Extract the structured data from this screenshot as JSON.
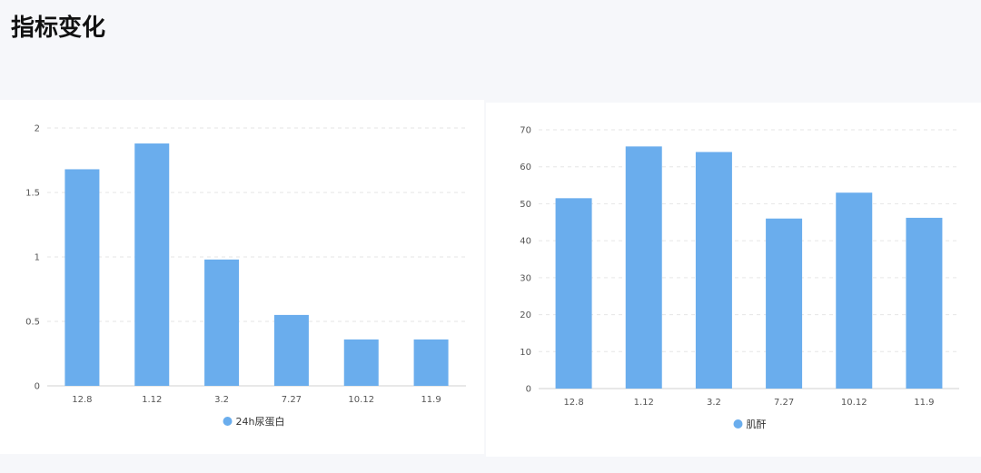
{
  "page": {
    "title": "指标变化"
  },
  "chart_data": [
    {
      "type": "bar",
      "categories": [
        "12.8",
        "1.12",
        "3.2",
        "7.27",
        "10.12",
        "11.9"
      ],
      "series": [
        {
          "name": "24h尿蛋白",
          "values": [
            1.68,
            1.88,
            0.98,
            0.55,
            0.36,
            0.36
          ]
        }
      ],
      "yticks": [
        "0",
        "0.5",
        "1",
        "1.5",
        "2"
      ],
      "ylim": [
        0,
        2
      ],
      "grid": true,
      "legend_position": "bottom-center",
      "bar_color": "#6aaded"
    },
    {
      "type": "bar",
      "categories": [
        "12.8",
        "1.12",
        "3.2",
        "7.27",
        "10.12",
        "11.9"
      ],
      "series": [
        {
          "name": "肌酐",
          "values": [
            51.5,
            65.5,
            64,
            46,
            53,
            46.2
          ]
        }
      ],
      "yticks": [
        "0",
        "10",
        "20",
        "30",
        "40",
        "50",
        "60",
        "70"
      ],
      "ylim": [
        0,
        70
      ],
      "grid": true,
      "legend_position": "bottom-center",
      "bar_color": "#6aaded"
    }
  ]
}
